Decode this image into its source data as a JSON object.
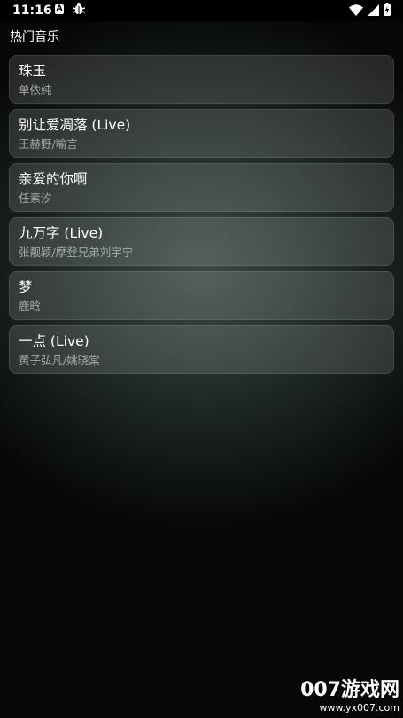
{
  "status_bar": {
    "time": "11:16",
    "icons": [
      "a-notification-icon",
      "bug-icon",
      "wifi-icon",
      "signal-icon",
      "battery-icon"
    ]
  },
  "section": {
    "title": "热门音乐"
  },
  "songs": [
    {
      "title": "珠玉",
      "artist": "单依纯"
    },
    {
      "title": "别让爱凋落 (Live)",
      "artist": "王赫野/喻言"
    },
    {
      "title": "亲爱的你啊",
      "artist": "任素汐"
    },
    {
      "title": "九万字 (Live)",
      "artist": "张靓颖/摩登兄弟刘宇宁"
    },
    {
      "title": "梦",
      "artist": "鹿晗"
    },
    {
      "title": "一点 (Live)",
      "artist": "黄子弘凡/姚晓棠"
    }
  ],
  "watermark": {
    "brand": "007游戏网",
    "url": "www.yx007.com"
  },
  "colors": {
    "card_background": "#3a403e",
    "artist_text": "#a5aaa8",
    "status_bar": "#000000"
  }
}
